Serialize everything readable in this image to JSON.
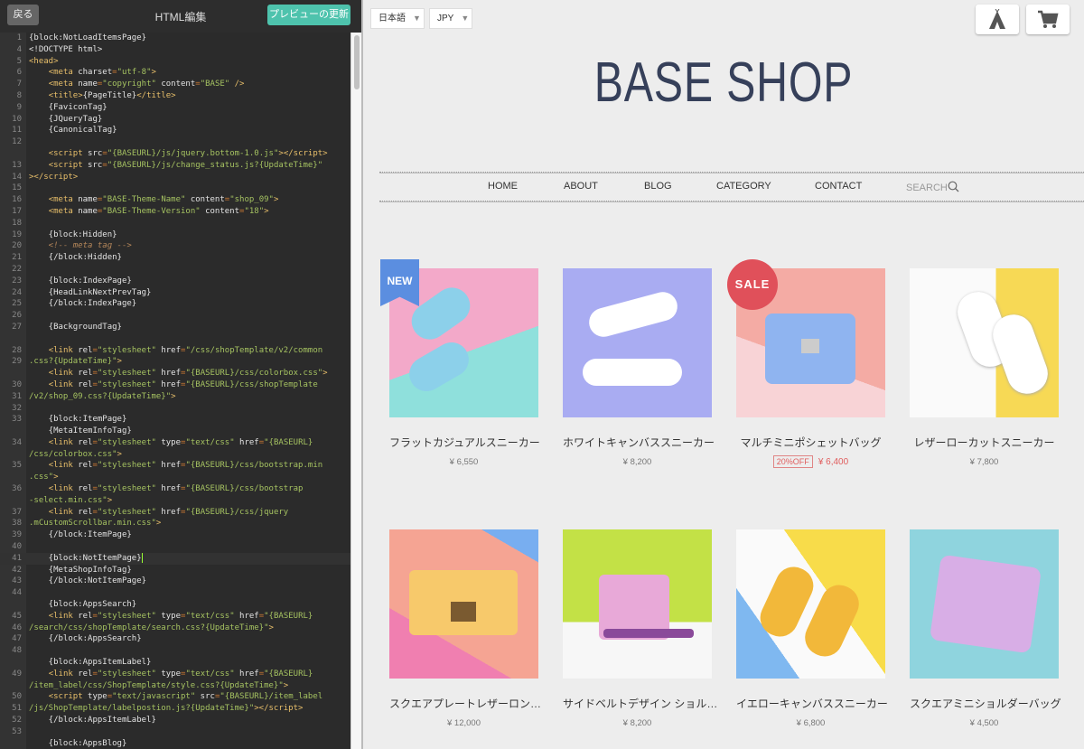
{
  "editor": {
    "back_label": "戻る",
    "title": "HTML編集",
    "refresh_label": "プレビューの更新",
    "lines": [
      {
        "n": "1",
        "c": "{block:NotLoadItemsPage}"
      },
      {
        "n": "4",
        "c": "<!DOCTYPE html>"
      },
      {
        "n": "5",
        "c": "<head>"
      },
      {
        "n": "6",
        "c": "    <meta charset=\"utf-8\">"
      },
      {
        "n": "7",
        "c": "    <meta name=\"copyright\" content=\"BASE\" />"
      },
      {
        "n": "8",
        "c": "    <title>{PageTitle}</title>"
      },
      {
        "n": "9",
        "c": "    {FaviconTag}"
      },
      {
        "n": "10",
        "c": "    {JQueryTag}"
      },
      {
        "n": "11",
        "c": "    {CanonicalTag}"
      },
      {
        "n": "12",
        "c": ""
      },
      {
        "n": "",
        "c": "    <script src=\"{BASEURL}/js/jquery.bottom-1.0.js\"></script>"
      },
      {
        "n": "13",
        "c": "    <script src=\"{BASEURL}/js/change_status.js?{UpdateTime}\""
      },
      {
        "n": "14",
        "c": "></script>"
      },
      {
        "n": "15",
        "c": ""
      },
      {
        "n": "16",
        "c": "    <meta name=\"BASE-Theme-Name\" content=\"shop_09\">"
      },
      {
        "n": "17",
        "c": "    <meta name=\"BASE-Theme-Version\" content=\"18\">"
      },
      {
        "n": "18",
        "c": ""
      },
      {
        "n": "19",
        "c": "    {block:Hidden}"
      },
      {
        "n": "20",
        "c": "    <!-- meta tag -->"
      },
      {
        "n": "21",
        "c": "    {/block:Hidden}"
      },
      {
        "n": "22",
        "c": ""
      },
      {
        "n": "23",
        "c": "    {block:IndexPage}"
      },
      {
        "n": "24",
        "c": "    {HeadLinkNextPrevTag}"
      },
      {
        "n": "25",
        "c": "    {/block:IndexPage}"
      },
      {
        "n": "26",
        "c": ""
      },
      {
        "n": "27",
        "c": "    {BackgroundTag}"
      },
      {
        "n": "",
        "c": ""
      },
      {
        "n": "28",
        "c": "    <link rel=\"stylesheet\" href=\"/css/shopTemplate/v2/common"
      },
      {
        "n": "29",
        "c": ".css?{UpdateTime}\">",
        "cont": true
      },
      {
        "n": "",
        "c": "    <link rel=\"stylesheet\" href=\"{BASEURL}/css/colorbox.css\">"
      },
      {
        "n": "30",
        "c": "    <link rel=\"stylesheet\" href=\"{BASEURL}/css/shopTemplate"
      },
      {
        "n": "31",
        "c": "/v2/shop_09.css?{UpdateTime}\">",
        "cont": true
      },
      {
        "n": "32",
        "c": ""
      },
      {
        "n": "33",
        "c": "    {block:ItemPage}"
      },
      {
        "n": "",
        "c": "    {MetaItemInfoTag}"
      },
      {
        "n": "34",
        "c": "    <link rel=\"stylesheet\" type=\"text/css\" href=\"{BASEURL}"
      },
      {
        "n": "",
        "c": "/css/colorbox.css\">",
        "cont": true
      },
      {
        "n": "35",
        "c": "    <link rel=\"stylesheet\" href=\"{BASEURL}/css/bootstrap.min"
      },
      {
        "n": "",
        "c": ".css\">",
        "cont": true
      },
      {
        "n": "36",
        "c": "    <link rel=\"stylesheet\" href=\"{BASEURL}/css/bootstrap"
      },
      {
        "n": "",
        "c": "-select.min.css\">",
        "cont": true
      },
      {
        "n": "37",
        "c": "    <link rel=\"stylesheet\" href=\"{BASEURL}/css/jquery"
      },
      {
        "n": "38",
        "c": ".mCustomScrollbar.min.css\">",
        "cont": true
      },
      {
        "n": "39",
        "c": "    {/block:ItemPage}"
      },
      {
        "n": "40",
        "c": ""
      },
      {
        "n": "41",
        "c": "    {block:NotItemPage}",
        "active": true
      },
      {
        "n": "42",
        "c": "    {MetaShopInfoTag}"
      },
      {
        "n": "43",
        "c": "    {/block:NotItemPage}"
      },
      {
        "n": "44",
        "c": ""
      },
      {
        "n": "",
        "c": "    {block:AppsSearch}"
      },
      {
        "n": "45",
        "c": "    <link rel=\"stylesheet\" type=\"text/css\" href=\"{BASEURL}"
      },
      {
        "n": "46",
        "c": "/search/css/shopTemplate/search.css?{UpdateTime}\">",
        "cont": true
      },
      {
        "n": "47",
        "c": "    {/block:AppsSearch}"
      },
      {
        "n": "48",
        "c": ""
      },
      {
        "n": "",
        "c": "    {block:AppsItemLabel}"
      },
      {
        "n": "49",
        "c": "    <link rel=\"stylesheet\" type=\"text/css\" href=\"{BASEURL}"
      },
      {
        "n": "",
        "c": "/item_label/css/ShopTemplate/style.css?{UpdateTime}\">",
        "cont": true
      },
      {
        "n": "50",
        "c": "    <script type=\"text/javascript\" src=\"{BASEURL}/item_label"
      },
      {
        "n": "51",
        "c": "/js/ShopTemplate/labelpostion.js?{UpdateTime}\"></script>",
        "cont": true
      },
      {
        "n": "52",
        "c": "    {/block:AppsItemLabel}"
      },
      {
        "n": "53",
        "c": ""
      },
      {
        "n": "",
        "c": "    {block:AppsBlog}"
      }
    ]
  },
  "preview": {
    "language": "日本語",
    "currency": "JPY",
    "logo": "BASE SHOP",
    "nav": [
      "HOME",
      "ABOUT",
      "BLOG",
      "CATEGORY",
      "CONTACT"
    ],
    "search_label": "SEARCH",
    "new_label": "NEW",
    "sale_label": "SALE",
    "products": [
      {
        "name": "フラットカジュアルスニーカー",
        "price": "¥ 6,550"
      },
      {
        "name": "ホワイトキャンバススニーカー",
        "price": "¥ 8,200"
      },
      {
        "name": "マルチミニポシェットバッグ",
        "price": "¥ 6,400",
        "discount": "20%OFF"
      },
      {
        "name": "レザーローカットスニーカー",
        "price": "¥ 7,800"
      },
      {
        "name": "スクエアプレートレザーロン…",
        "price": "¥ 12,000"
      },
      {
        "name": "サイドベルトデザイン ショル…",
        "price": "¥ 8,200"
      },
      {
        "name": "イエローキャンバススニーカー",
        "price": "¥ 6,800"
      },
      {
        "name": "スクエアミニショルダーバッグ",
        "price": "¥ 4,500"
      }
    ]
  }
}
